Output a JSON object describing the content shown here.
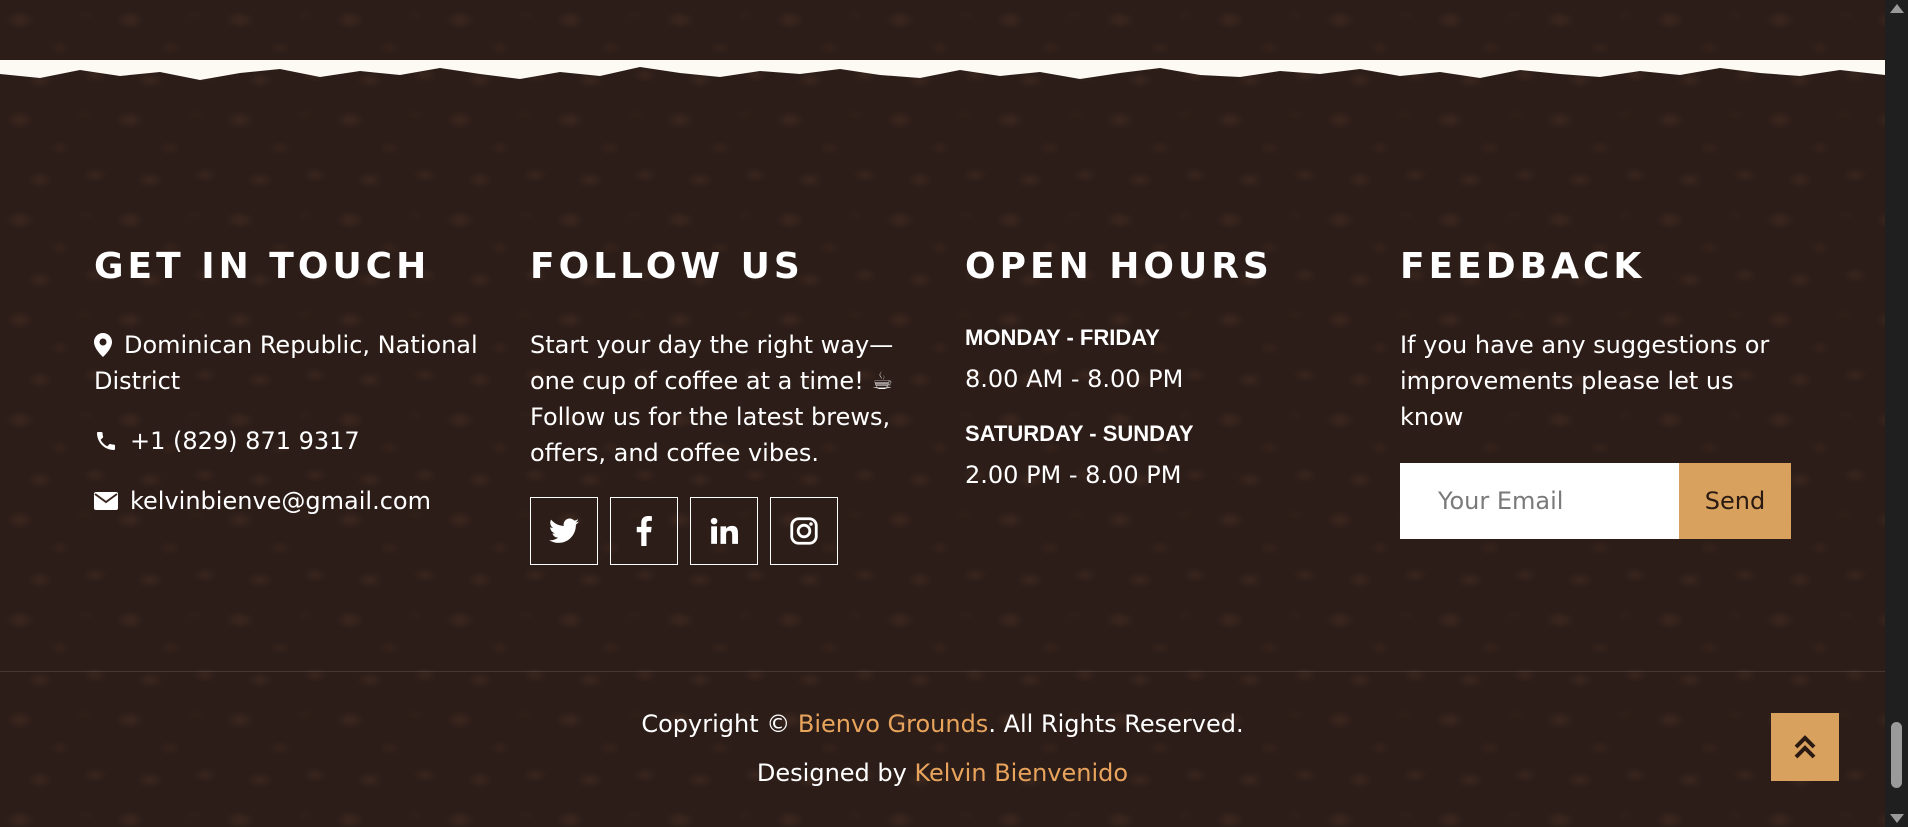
{
  "contact": {
    "title": "GET IN TOUCH",
    "address": "Dominican Republic, National District",
    "phone": "+1 (829) 871 9317",
    "email": "kelvinbienve@gmail.com"
  },
  "follow": {
    "title": "FOLLOW US",
    "text_line1": "Start your day the right way—",
    "text_line2": "one cup of coffee at a time! ☕",
    "text_line3": "Follow us for the latest brews,",
    "text_line4": "offers, and coffee vibes.",
    "socials": [
      "twitter-icon",
      "facebook-icon",
      "linkedin-icon",
      "instagram-icon"
    ]
  },
  "hours": {
    "title": "OPEN HOURS",
    "weekday_label": "MONDAY - FRIDAY",
    "weekday_time": "8.00 AM - 8.00 PM",
    "weekend_label": "SATURDAY - SUNDAY",
    "weekend_time": "2.00 PM - 8.00 PM"
  },
  "feedback": {
    "title": "FEEDBACK",
    "text": "If you have any suggestions or improvements please let us know",
    "email_placeholder": "Your Email",
    "send_label": "Send"
  },
  "footer": {
    "copyright_prefix": "Copyright ©",
    "brand": "Bienvo Grounds",
    "copyright_suffix": ". All Rights Reserved.",
    "designed_prefix": "Designed by",
    "designer": "Kelvin Bienvenido"
  },
  "colors": {
    "background": "#2e1f1a",
    "accent": "#d8a15e",
    "link": "#e8a45c",
    "top_strip": "#fdf9f3"
  }
}
